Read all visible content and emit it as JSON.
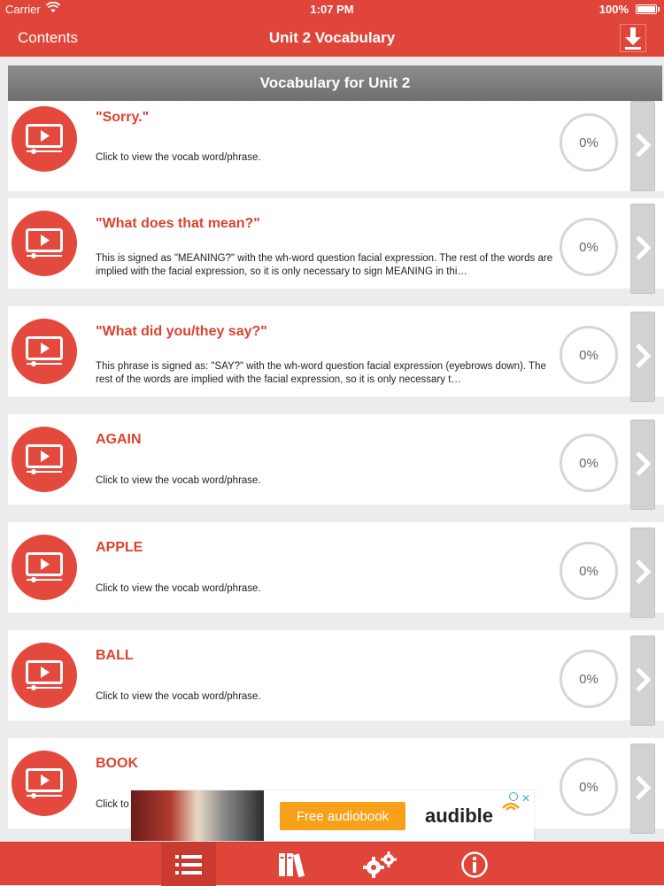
{
  "status_bar": {
    "carrier": "Carrier",
    "time": "1:07 PM",
    "battery": "100%"
  },
  "nav": {
    "back_label": "Contents",
    "title": "Unit 2 Vocabulary",
    "download_icon": "download-icon"
  },
  "section_header": "Vocabulary for Unit 2",
  "items": [
    {
      "word": "\"Sorry.\"",
      "description": "Click to view the vocab word/phrase.",
      "progress": "0%"
    },
    {
      "word": "\"What does that mean?\"",
      "description": "This is signed as \"MEANING?\" with the wh-word question facial expression. The rest of the words are implied with the facial expression, so it is only necessary to sign MEANING in thi…",
      "progress": "0%"
    },
    {
      "word": "\"What did you/they say?\"",
      "description": "This phrase is signed as: \"SAY?\" with the wh-word question facial expression (eyebrows down). The rest of the words are implied with the facial expression, so it is only necessary t…",
      "progress": "0%"
    },
    {
      "word": "AGAIN",
      "description": "Click to view the vocab word/phrase.",
      "progress": "0%"
    },
    {
      "word": "APPLE",
      "description": "Click to view the vocab word/phrase.",
      "progress": "0%"
    },
    {
      "word": "BALL",
      "description": "Click to view the vocab word/phrase.",
      "progress": "0%"
    },
    {
      "word": "BOOK",
      "description": "Click to",
      "progress": "0%"
    }
  ],
  "ad": {
    "cta": "Free audiobook",
    "brand": "audible"
  },
  "tabs": [
    {
      "icon": "list-icon",
      "active": true
    },
    {
      "icon": "books-icon",
      "active": false
    },
    {
      "icon": "settings-gears-icon",
      "active": false
    },
    {
      "icon": "info-icon",
      "active": false
    }
  ],
  "colors": {
    "accent": "#e0453a",
    "header_gray": "#7d7d7d",
    "word_red": "#d9432f"
  }
}
